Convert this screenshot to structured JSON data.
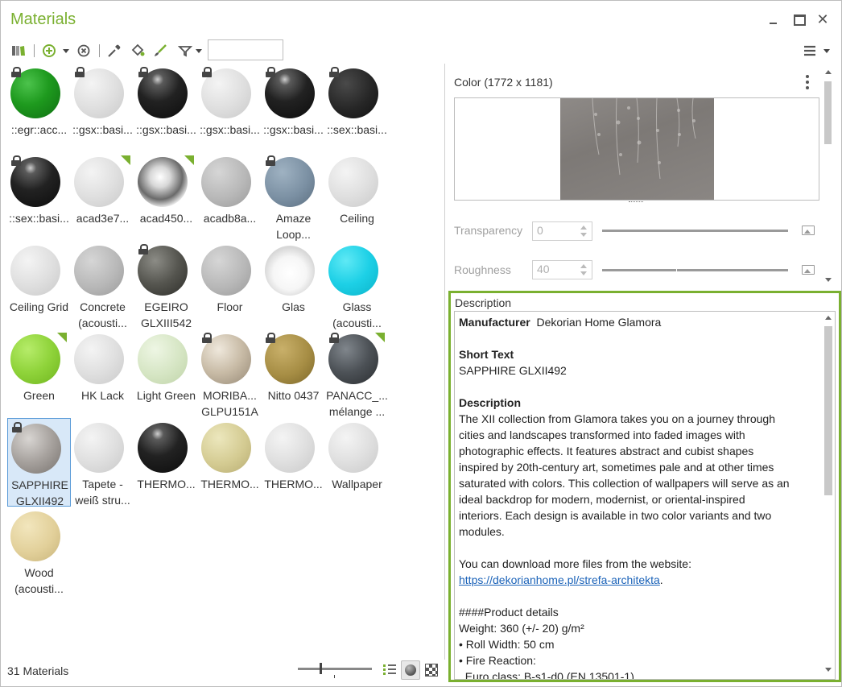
{
  "window": {
    "title": "Materials",
    "minimize_icon": "minimize-icon",
    "maximize_icon": "maximize-icon",
    "close_icon": "close-icon",
    "accent_color": "#7ab030"
  },
  "toolbar": {
    "search_value": "",
    "icons": [
      "library-icon",
      "add-icon",
      "dropdown-arrow-icon",
      "remove-icon",
      "eyedropper-icon",
      "paint-bucket-icon",
      "brush-icon",
      "filter-icon",
      "hamburger-menu-icon"
    ]
  },
  "materials": [
    {
      "label": "::egr::acc...",
      "locked": true,
      "corner": false,
      "sphere": "green-glossy"
    },
    {
      "label": "::gsx::basi...",
      "locked": true,
      "corner": false,
      "sphere": "white-matte"
    },
    {
      "label": "::gsx::basi...",
      "locked": true,
      "corner": false,
      "sphere": "black-glossy"
    },
    {
      "label": "::gsx::basi...",
      "locked": true,
      "corner": false,
      "sphere": "white-matte"
    },
    {
      "label": "::gsx::basi...",
      "locked": true,
      "corner": false,
      "sphere": "black-glossy"
    },
    {
      "label": "::sex::basi...",
      "locked": true,
      "corner": false,
      "sphere": "black-matte"
    },
    {
      "label": "::sex::basi...",
      "locked": true,
      "corner": false,
      "sphere": "black-glossy"
    },
    {
      "label": "acad3e7...",
      "locked": false,
      "corner": true,
      "sphere": "white-matte"
    },
    {
      "label": "acad450...",
      "locked": false,
      "corner": true,
      "sphere": "chrome"
    },
    {
      "label": "acadb8a...",
      "locked": false,
      "corner": false,
      "sphere": "grey-matte"
    },
    {
      "label": "Amaze Loop...",
      "locked": true,
      "corner": false,
      "sphere": "slate-blue"
    },
    {
      "label": "Ceiling",
      "locked": false,
      "corner": false,
      "sphere": "white-matte"
    },
    {
      "label": "Ceiling Grid",
      "locked": false,
      "corner": false,
      "sphere": "white-matte"
    },
    {
      "label": "Concrete (acousti...",
      "locked": false,
      "corner": false,
      "sphere": "grey-matte"
    },
    {
      "label": "EGEIRO GLXIII542",
      "locked": true,
      "corner": false,
      "sphere": "dark-texture"
    },
    {
      "label": "Floor",
      "locked": false,
      "corner": false,
      "sphere": "grey-matte"
    },
    {
      "label": "Glas",
      "locked": false,
      "corner": false,
      "sphere": "glass"
    },
    {
      "label": "Glass (acousti...",
      "locked": false,
      "corner": false,
      "sphere": "cyan"
    },
    {
      "label": "Green",
      "locked": false,
      "corner": true,
      "sphere": "lime"
    },
    {
      "label": "HK Lack",
      "locked": false,
      "corner": false,
      "sphere": "white-matte"
    },
    {
      "label": "Light Green",
      "locked": false,
      "corner": false,
      "sphere": "pale-green"
    },
    {
      "label": "MORIBA... GLPU151A",
      "locked": true,
      "corner": false,
      "sphere": "beige-texture"
    },
    {
      "label": "Nitto 0437",
      "locked": true,
      "corner": false,
      "sphere": "olive-gold"
    },
    {
      "label": "PANACC_... mélange ...",
      "locked": true,
      "corner": true,
      "sphere": "dark-slate"
    },
    {
      "label": "SAPPHIRE GLXII492",
      "locked": true,
      "corner": false,
      "sphere": "grey-texture",
      "selected": true
    },
    {
      "label": "Tapete - weiß stru...",
      "locked": false,
      "corner": false,
      "sphere": "white-matte"
    },
    {
      "label": "THERMO...",
      "locked": false,
      "corner": false,
      "sphere": "black-glossy"
    },
    {
      "label": "THERMO...",
      "locked": false,
      "corner": false,
      "sphere": "khaki"
    },
    {
      "label": "THERMO...",
      "locked": false,
      "corner": false,
      "sphere": "white-matte"
    },
    {
      "label": "Wallpaper",
      "locked": false,
      "corner": false,
      "sphere": "white-matte"
    },
    {
      "label": "Wood (acousti...",
      "locked": false,
      "corner": false,
      "sphere": "wood-cream"
    }
  ],
  "status": {
    "count": "31 Materials",
    "zoom_level": 0.3
  },
  "properties": {
    "color_label": "Color (1772 x 1181)",
    "transparency_label": "Transparency",
    "transparency_value": "0",
    "roughness_label": "Roughness",
    "roughness_value": "40",
    "description_title": "Description"
  },
  "description": {
    "manufacturer_label": "Manufacturer",
    "manufacturer_value": "Dekorian Home Glamora",
    "short_text_label": "Short Text",
    "short_text_value": "SAPPHIRE GLXII492",
    "description_label": "Description",
    "description_lines": [
      "The XII collection from Glamora takes you on a journey through",
      "cities and landscapes transformed into faded images with",
      "photographic effects. It features abstract and cubist shapes",
      "inspired by 20th-century art, sometimes pale and at other times",
      "saturated with colors. This collection of wallpapers will serve as an",
      "ideal backdrop for modern, modernist, or oriental-inspired",
      "interiors. Each design is available in two color variants and two",
      "modules."
    ],
    "download_text": "You can download more files from the website:",
    "link": "https://dekorianhome.pl/strefa-architekta",
    "link_suffix": ".",
    "details_heading": "####Product details",
    "details_lines": [
      "Weight: 360 (+/- 20) g/m²",
      "• Roll Width: 50 cm",
      "• Fire Reaction:",
      "  Euro class: B-s1-d0 (EN 13501-1)"
    ]
  }
}
